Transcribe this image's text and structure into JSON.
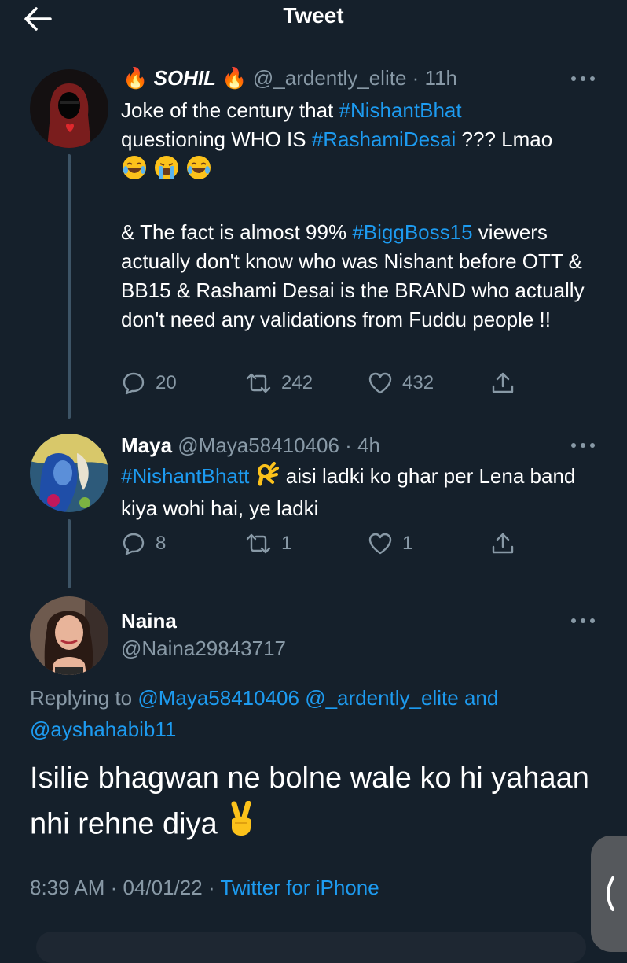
{
  "header": {
    "title": "Tweet"
  },
  "tweets": [
    {
      "name": "SOHIL",
      "handle": "@_ardently_elite",
      "time": "· 11h",
      "body": {
        "line1_a": "Joke of the century that ",
        "tag1": "#NishantBhat",
        "line2_a": "questioning WHO IS ",
        "tag2": "#RashamiDesai",
        "line2_b": " ??? Lmao",
        "p2_a": "& The fact is almost 99% ",
        "tag3": "#BiggBoss15",
        "p2_b": " viewers actually don't know who was Nishant before OTT & BB15 & Rashami Desai is the BRAND who actually don't need any validations from Fuddu people !!"
      },
      "stats": {
        "replies": "20",
        "retweets": "242",
        "likes": "432"
      }
    },
    {
      "name": "Maya",
      "handle": "@Maya58410406",
      "time": "· 4h",
      "body": {
        "tag1": "#NishantBhatt",
        "text_a": " aisi ladki ko ghar per Lena band kiya wohi hai, ye ladki"
      },
      "stats": {
        "replies": "8",
        "retweets": "1",
        "likes": "1"
      }
    }
  ],
  "main_tweet": {
    "name": "Naina",
    "handle": "@Naina29843717",
    "replying_prefix": "Replying to ",
    "mention1": "@Maya58410406",
    "mention2": "@_ardently_elite",
    "and_word": " and",
    "mention3": "@ayshahabib11",
    "text": "Isilie bhagwan ne bolne wale ko hi yahaan nhi rehne diya",
    "time": "8:39 AM",
    "sep1": " · ",
    "date": "04/01/22",
    "sep2": " · ",
    "source": "Twitter for iPhone"
  },
  "colors": {
    "background": "#15202b",
    "accent": "#1d9bf0",
    "secondary_text": "#8899a6"
  }
}
